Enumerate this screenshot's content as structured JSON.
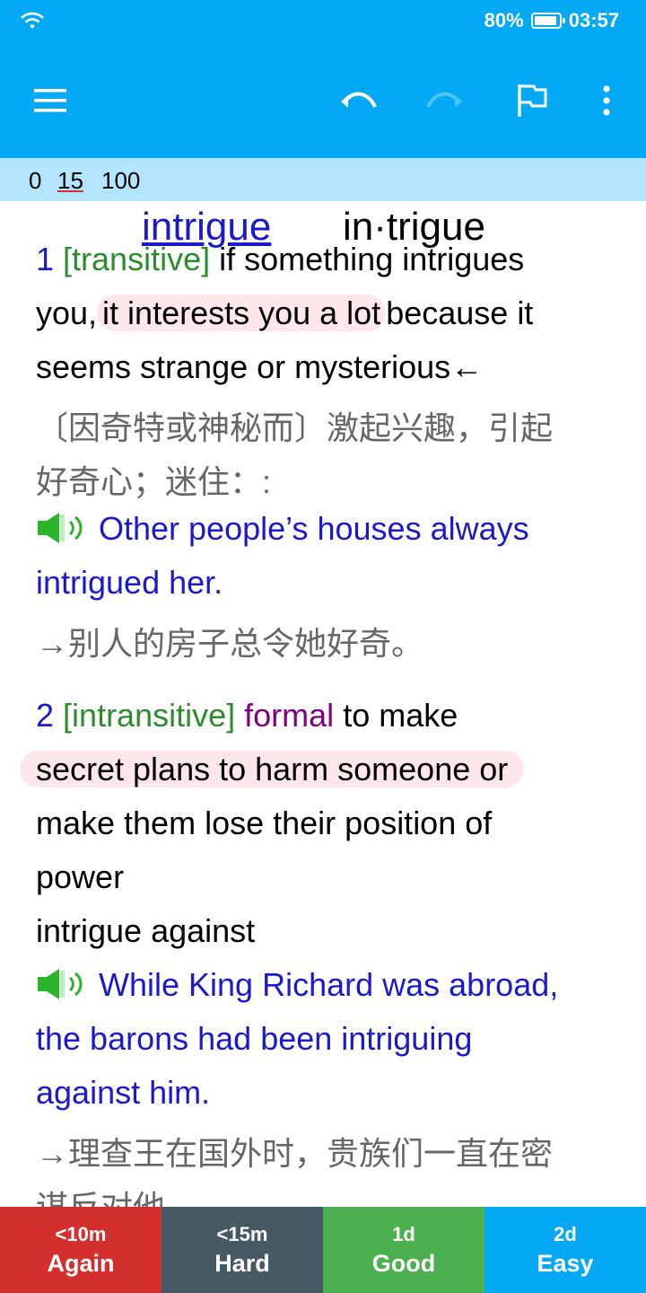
{
  "status": {
    "battery": "80%",
    "time": "03:57"
  },
  "toolbar": {
    "icons": [
      "menu-icon",
      "undo-icon",
      "redo-icon",
      "flag-icon",
      "more-vert-icon"
    ]
  },
  "counter": {
    "new": "0",
    "learning": "15",
    "review": "100"
  },
  "entry": {
    "headword": "intrigue",
    "pronunciation": "in·trigue",
    "sense1": {
      "num": "1",
      "gram": "[transitive]",
      "def_a": " if something intrigues",
      "def_b_pre": "you,",
      "def_b_hl": "it interests you a lot",
      "def_b_post": "because it",
      "def_c": "seems strange or mysterious←",
      "zh_a": "〔因奇特或神秘而〕激起兴趣，引起",
      "zh_b": "好奇心；迷住：:",
      "ex_a": "Other people’s houses always",
      "ex_b": "intrigued her.",
      "ex_zh": "→别人的房子总令她好奇。"
    },
    "sense2": {
      "num": "2",
      "gram": "[intransitive]",
      "reg": "formal",
      "def_a": "to make",
      "def_b_hl": "secret plans to harm someone or",
      "def_c": "make them lose their position of",
      "def_d": "power",
      "phrase": "intrigue against",
      "ex_a": "While King Richard was abroad,",
      "ex_b": "the barons had been intriguing",
      "ex_c": "against him.",
      "ex_zh_a": "→理查王在国外时，贵族们一直在密",
      "ex_zh_b": "谋反对他。"
    }
  },
  "answers": [
    {
      "time": "<10m",
      "label": "Again",
      "color": "#d32f2f"
    },
    {
      "time": "<15m",
      "label": "Hard",
      "color": "#455a64"
    },
    {
      "time": "1d",
      "label": "Good",
      "color": "#4caf50"
    },
    {
      "time": "2d",
      "label": "Easy",
      "color": "#03a9f4"
    }
  ]
}
